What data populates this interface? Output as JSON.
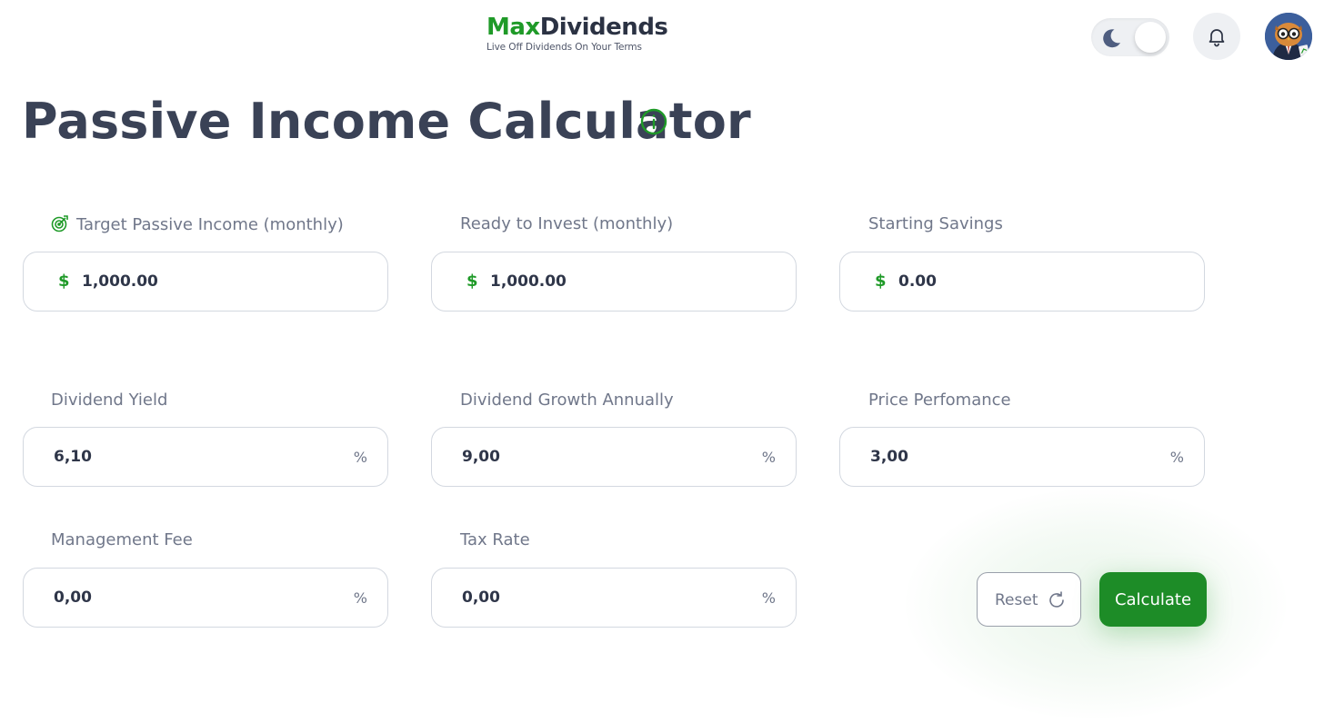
{
  "header": {
    "logo_part1": "Max",
    "logo_part2": "Dividends",
    "tagline": "Live Off Dividends On Your Terms",
    "theme_toggle_icon": "moon-icon",
    "notification_icon": "bell-icon",
    "avatar_icon": "owl-avatar"
  },
  "page": {
    "title": "Passive Income Calculator",
    "info_icon": "info-icon"
  },
  "fields": {
    "target_income": {
      "label": "Target Passive Income (monthly)",
      "currency": "$",
      "value": "1,000.00",
      "icon": "target-icon"
    },
    "ready_to_invest": {
      "label": "Ready to Invest (monthly)",
      "currency": "$",
      "value": "1,000.00"
    },
    "starting_savings": {
      "label": "Starting Savings",
      "currency": "$",
      "value": "0.00"
    },
    "dividend_yield": {
      "label": "Dividend Yield",
      "value": "6,10",
      "unit": "%"
    },
    "dividend_growth": {
      "label": "Dividend Growth Annually",
      "value": "9,00",
      "unit": "%"
    },
    "price_performance": {
      "label": "Price Perfomance",
      "value": "3,00",
      "unit": "%"
    },
    "management_fee": {
      "label": "Management Fee",
      "value": "0,00",
      "unit": "%"
    },
    "tax_rate": {
      "label": "Tax Rate",
      "value": "0,00",
      "unit": "%"
    }
  },
  "actions": {
    "reset_label": "Reset",
    "reset_icon": "refresh-icon",
    "calculate_label": "Calculate"
  },
  "colors": {
    "brand_green": "#1f9a28",
    "button_green": "#1d8c27",
    "text_dark": "#3a4256",
    "text_muted": "#70778a",
    "border": "#d3d8e0"
  }
}
